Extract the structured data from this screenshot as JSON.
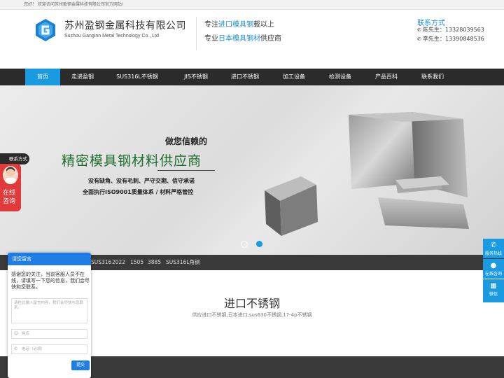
{
  "topbar": {
    "welcome": "您好！ 欢迎访问苏州盈钢金属科技有限公司官方网站!"
  },
  "header": {
    "company_cn": "苏州盈钢金属科技有限公司",
    "company_en": "Suzhou Ganginn Metal Technology Co., Ltd",
    "slogan1_pre": "专注",
    "slogan1_hl": "进口模具钢",
    "slogan1_post": "载以上",
    "slogan2_pre": "专业",
    "slogan2_hl": "日本模具钢材",
    "slogan2_post": "供应商",
    "contact_title": "联系方式",
    "contact1": "陈先生：13328039563",
    "contact2": "李先生：13390848536"
  },
  "nav": [
    "首页",
    "走进盈钢",
    "SUS316L不锈钢",
    "JIS不锈钢",
    "进口不锈钢",
    "加工设备",
    "检测设备",
    "产品百科",
    "联系我们"
  ],
  "banner": {
    "line1": "做您信赖的",
    "line2": "精密模具钢材料供应商",
    "line3": "没有缺角、没有毛刺、严守交期、信守承诺",
    "line4": "全面执行ISO9001质量体系 / 材料严格管控",
    "slide_count": 2,
    "active_slide": 2
  },
  "tags": [
    "SUS316",
    "2022",
    "1505",
    "3885",
    "SUS316L角钢"
  ],
  "section": {
    "title": "进口不锈钢",
    "subtitle": "供应进口不锈钢,日本进口,sus630不锈钢,17-4p不锈钢"
  },
  "float_left": {
    "contact_tab": "联系方式",
    "online": "在线",
    "consult": "咨询"
  },
  "float_right": {
    "hotline": "服务热线",
    "online": "在线咨询",
    "wechat": "微信"
  },
  "chat": {
    "title": "请您留言",
    "message": "感谢您的关注，当前客服人员不在线，请填写一下您的信息，我们会尽快和您联系。",
    "content_placeholder": "请在此输入留言内容，我们会尽快与您联系。",
    "name_placeholder": "姓名",
    "phone_placeholder": "电话（必填）",
    "submit": "提交"
  },
  "colors": {
    "accent": "#1a9ae0",
    "nav_bg": "#2b2b2b",
    "banner_green": "#1d6d2f",
    "float_red": "#e03a3a"
  }
}
